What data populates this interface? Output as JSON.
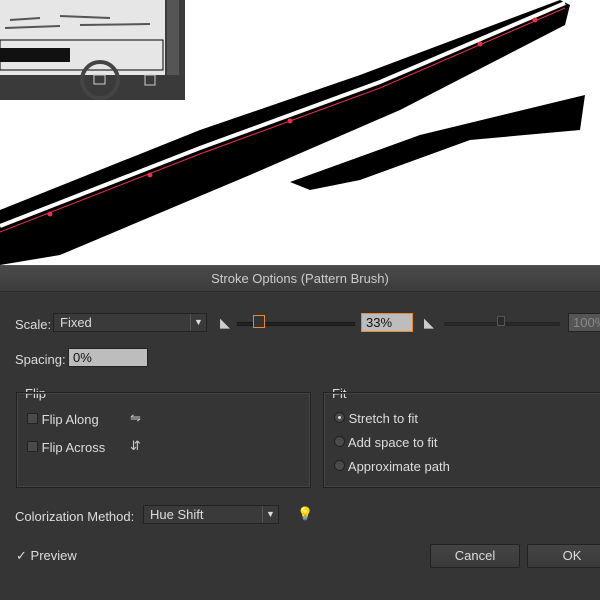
{
  "dialog": {
    "title": "Stroke Options (Pattern Brush)",
    "scale": {
      "label": "Scale:",
      "value": "Fixed",
      "percent": "33%",
      "slider_value": 33,
      "max_percent": "100%"
    },
    "spacing": {
      "label": "Spacing:",
      "value": "0%"
    },
    "flip": {
      "title": "Flip",
      "along": {
        "label": "Flip Along",
        "checked": false
      },
      "across": {
        "label": "Flip Across",
        "checked": false
      }
    },
    "fit": {
      "title": "Fit",
      "options": [
        {
          "label": "Stretch to fit",
          "selected": true
        },
        {
          "label": "Add space to fit",
          "selected": false
        },
        {
          "label": "Approximate path",
          "selected": false
        }
      ]
    },
    "colorization": {
      "label": "Colorization Method:",
      "value": "Hue Shift"
    },
    "preview": {
      "label": "Preview",
      "checked": true
    },
    "cancel": "Cancel",
    "ok": "OK"
  },
  "colors": {
    "accent": "#e8892b",
    "dialog_bg": "#353535",
    "path_point": "#e8304a"
  }
}
